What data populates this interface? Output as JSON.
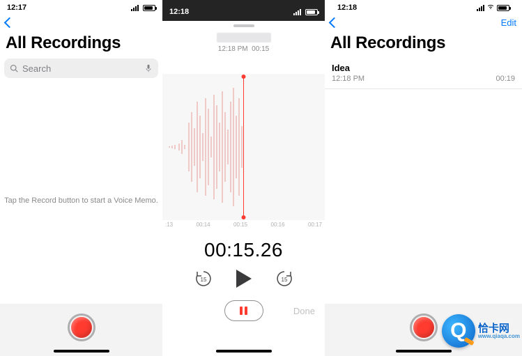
{
  "phone1": {
    "time": "12:17",
    "title": "All Recordings",
    "search_placeholder": "Search",
    "empty": "Tap the Record button to start a Voice Memo."
  },
  "phone2": {
    "time": "12:18",
    "sub_time": "12:18 PM",
    "sub_dur": "00:15",
    "ticks": [
      ":13",
      "00:14",
      "00:15",
      "00:16",
      "00:17"
    ],
    "big_time": "00:15.26",
    "skip_amount": "15",
    "done": "Done"
  },
  "phone3": {
    "time": "12:18",
    "edit": "Edit",
    "title": "All Recordings",
    "item": {
      "name": "Idea",
      "time": "12:18 PM",
      "dur": "00:19"
    }
  },
  "watermark": {
    "letter": "Q",
    "brand": "恰卡网",
    "url": "www.qiaqa.com"
  }
}
